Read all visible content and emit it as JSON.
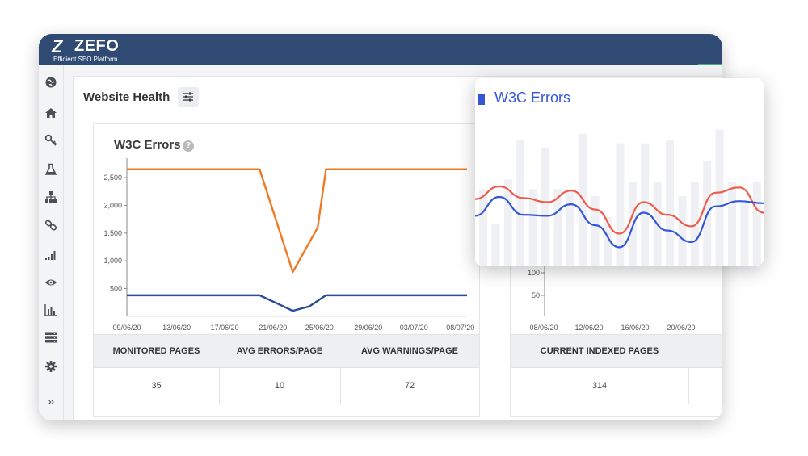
{
  "app": {
    "logo_mark": "Z",
    "name": "ZEFO",
    "tagline": "Efficient SEO Platform",
    "colors": {
      "topbar": "#2f4b74",
      "accent": "#3fb27f",
      "orange": "#f07a24",
      "navy": "#2b4c9a",
      "popup_blue": "#3456d8",
      "popup_red": "#f05a4a"
    }
  },
  "sidebar": {
    "items": [
      {
        "icon": "globe-icon"
      },
      {
        "icon": "home-icon"
      },
      {
        "icon": "key-icon"
      },
      {
        "icon": "flask-icon"
      },
      {
        "icon": "sitemap-icon"
      },
      {
        "icon": "link-icon"
      },
      {
        "icon": "signal-icon"
      },
      {
        "icon": "eye-icon"
      },
      {
        "icon": "bar-chart-icon"
      },
      {
        "icon": "server-icon"
      },
      {
        "icon": "gear-icon"
      }
    ],
    "expand_label": "»"
  },
  "content": {
    "title": "Website Health",
    "filter_icon": "sliders-icon"
  },
  "w3c_panel": {
    "title": "W3C Errors",
    "help": "?",
    "stats": {
      "headers": [
        "MONITORED PAGES",
        "AVG ERRORS/PAGE",
        "AVG WARNINGS/PAGE"
      ],
      "values": [
        "35",
        "10",
        "72"
      ]
    }
  },
  "indexed_panel": {
    "stats": {
      "headers": [
        "CURRENT INDEXED PAGES"
      ],
      "values": [
        "314"
      ]
    }
  },
  "popup": {
    "title": "W3C Errors"
  },
  "chart_data": [
    {
      "type": "line",
      "title": "W3C Errors",
      "x_ticks": [
        "09/06/20",
        "13/06/20",
        "17/06/20",
        "21/06/20",
        "25/06/20",
        "29/06/20",
        "03/07/20",
        "08/07/20"
      ],
      "y_ticks": [
        "2,500",
        "2,000",
        "1,500",
        "1,000",
        "500"
      ],
      "ylim": [
        0,
        2850
      ],
      "x": [
        0,
        16,
        20,
        24,
        41
      ],
      "series": [
        {
          "color": "#f07a24",
          "values": [
            2650,
            2650,
            800,
            2650,
            2650
          ],
          "extra": {
            "x": 23,
            "y": 1600
          }
        },
        {
          "color": "#2b4c9a",
          "values": [
            380,
            380,
            100,
            380,
            380
          ],
          "extra": {
            "x": 22,
            "y": 180
          }
        }
      ]
    },
    {
      "type": "line",
      "title": "",
      "x_ticks": [
        "08/06/20",
        "12/06/20",
        "16/06/20",
        "20/06/20"
      ],
      "y_ticks": [
        "100",
        "50"
      ]
    },
    {
      "type": "line",
      "title": "W3C Errors",
      "bars": [
        0.55,
        0.3,
        0.62,
        0.9,
        0.55,
        0.85,
        0.55,
        0.55,
        0.95,
        0.5,
        0.35,
        0.88,
        0.6,
        0.88,
        0.6,
        0.9,
        0.5,
        0.6,
        0.75,
        0.98,
        0.6,
        0.45,
        0.6
      ],
      "series": [
        {
          "name": "",
          "color": "#f05a4a",
          "values": [
            0.48,
            0.6,
            0.49,
            0.45,
            0.56,
            0.38,
            0.15,
            0.45,
            0.33,
            0.22,
            0.54,
            0.59,
            0.35
          ]
        },
        {
          "name": "",
          "color": "#3456d8",
          "values": [
            0.32,
            0.5,
            0.33,
            0.32,
            0.43,
            0.23,
            0.02,
            0.35,
            0.18,
            0.07,
            0.41,
            0.46,
            0.44
          ]
        }
      ]
    }
  ]
}
